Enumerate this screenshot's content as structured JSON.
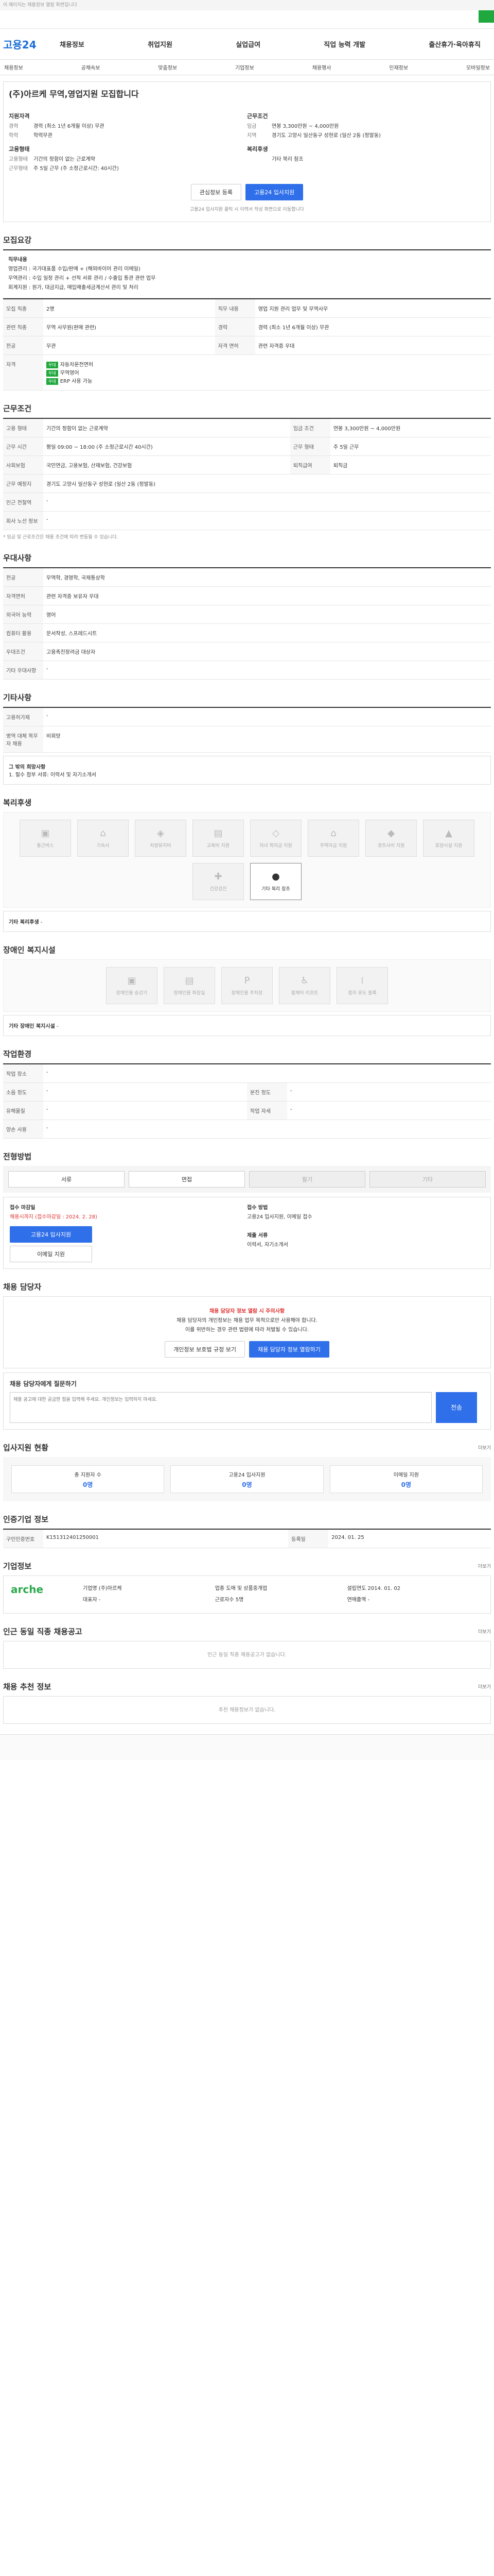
{
  "topbar": {
    "notice": "이 페이지는 채용정보 열람 화면입니다"
  },
  "logo": "고용24",
  "menu": [
    "채용정보",
    "취업지원",
    "실업급여",
    "직업 능력 개발",
    "출산휴가·육아휴직"
  ],
  "subnav": [
    "채용정보",
    "공채속보",
    "맞춤정보",
    "기업정보",
    "채용행사",
    "인재정보",
    "모바일정보"
  ],
  "job": {
    "title": "(주)아르케 무역,영업지원 모집합니다",
    "left_label": "지원자격",
    "left": [
      {
        "k": "경력",
        "v": "경력 (최소 1년 6개월 이상) 무관"
      },
      {
        "k": "학력",
        "v": "학력무관"
      }
    ],
    "left_label2": "고용형태",
    "left2": [
      {
        "k": "고용형태",
        "v": "기간의 정함이 없는 근로계약"
      },
      {
        "k": "근무형태",
        "v": "주 5일 근무 (주 소정근로시간: 40시간)"
      }
    ],
    "right_label": "근무조건",
    "right": [
      {
        "k": "임금",
        "v": "연봉 3,300만원 ~ 4,000만원"
      },
      {
        "k": "지역",
        "v": "경기도 고양시 일산동구 성현로 (일산 2동 (정발동)"
      }
    ],
    "right_label2": "복리후생",
    "right2": [
      {
        "k": "",
        "v": "기타 복리 참조"
      }
    ],
    "btn_save": "관심정보 등록",
    "btn_apply": "고용24 입사지원",
    "fine": "고용24 입사지원 클릭 시 이력서 작성 화면으로 이동합니다"
  },
  "sections": {
    "recruit": "모집요강",
    "workcond": "근무조건",
    "welfare": "복리후생",
    "disabled": "장애인 복지시설",
    "extra": "우대사항",
    "req": "기타사항",
    "manager": "채용 담당자",
    "method": "전형방법",
    "apply": "접수방법",
    "stat": "입사지원 현황",
    "company": "기업정보",
    "other": "인근 동일 직종 채용공고",
    "rec": "채용 추천 정보"
  },
  "recruit": {
    "desc_title": "직무내용",
    "desc_lines": [
      "영업관리 : 국가대표품 수입/판매 + (해외바이어 관리 이메일)",
      "무역관리 : 수입 일정 관리 + 선적 서류 관리 / 수출입 통관 관련 업무",
      "회계지원 : 원가, 대금지급, 매입매출세금계산서 관리 및 처리"
    ],
    "rows": [
      {
        "k": "모집 직종",
        "v": "2명"
      },
      {
        "k": "직무 내용",
        "v": "영업 지원 관리 업무 및 무역사무"
      },
      {
        "k": "관련 직종",
        "v": "무역 사무원(판매 관련)"
      },
      {
        "k": "경력",
        "v": "경력 (최소 1년 6개월 이상) 무관"
      },
      {
        "k": "전공",
        "v": "무관"
      },
      {
        "k": "자격 면허",
        "v": "관련 자격증 우대"
      }
    ],
    "tags": [
      {
        "tag": "우대",
        "text": "자동차운전면허"
      },
      {
        "tag": "우대",
        "text": "무역영어"
      },
      {
        "tag": "우대",
        "text": "ERP 사용 가능"
      }
    ]
  },
  "workcond": {
    "rows": [
      {
        "k": "고용 형태",
        "v": "기간의 정함이 없는 근로계약"
      },
      {
        "k": "임금 조건",
        "v": "연봉 3,300만원 ~ 4,000만원"
      },
      {
        "k": "근무 시간",
        "v": "평일 09:00 ~ 18:00 (주 소정근로시간 40시간)"
      },
      {
        "k": "근무 형태",
        "v": "주 5일 근무"
      },
      {
        "k": "사회보험",
        "v": "국민연금, 고용보험, 산재보험, 건강보험"
      },
      {
        "k": "퇴직급여",
        "v": "퇴직금"
      },
      {
        "k": "근무 예정지",
        "v": "경기도 고양시 일산동구 성현로 (일산 2동 (정발동)"
      },
      {
        "k": "인근 전철역",
        "v": "-"
      },
      {
        "k": "회사 노선 정보",
        "v": "-"
      }
    ],
    "note": "* 임금 및 근로조건은 채용 조건에 따라 변동될 수 있습니다."
  },
  "extra": {
    "rows": [
      {
        "k": "전공",
        "v": "무역학, 경영학, 국제통상학"
      },
      {
        "k": "자격면허",
        "v": "관련 자격증 보유자 우대"
      },
      {
        "k": "외국어 능력",
        "v": "영어"
      },
      {
        "k": "컴퓨터 활용",
        "v": "문서작성, 스프레드시트"
      },
      {
        "k": "우대조건",
        "v": "고용촉진장려금 대상자"
      },
      {
        "k": "기타 우대사항",
        "v": "-"
      }
    ]
  },
  "req": {
    "rows": [
      {
        "k": "고용허가제",
        "v": "-"
      },
      {
        "k": "병역 대체 복무자 채용",
        "v": "비희망"
      }
    ],
    "etc_title": "그 밖의 희망사항",
    "etc": "1. 필수 첨부 서류: 이력서 및 자기소개서"
  },
  "welfare": {
    "items": [
      "통근버스",
      "기숙사",
      "차량유지비",
      "교육비 지원",
      "자녀 학자금 지원",
      "주택자금 지원",
      "경조사비 지원",
      "휴양시설 지원",
      "건강검진",
      "기타 복리 참조"
    ],
    "note": "기타 복리후생",
    "note_v": "-"
  },
  "disabled": {
    "items": [
      "장애인용 승강기",
      "장애인용 화장실",
      "장애인용 주차장",
      "휠체어 리프트",
      "점자 유도 블록"
    ],
    "note": "기타 장애인 복지시설",
    "note_v": "-"
  },
  "workplace": {
    "title": "작업환경",
    "rows": [
      {
        "k": "작업 장소",
        "v": "-"
      },
      {
        "k": "소음 정도",
        "v": "-"
      },
      {
        "k": "분진 정도",
        "v": "-"
      },
      {
        "k": "유해물질",
        "v": "-"
      },
      {
        "k": "작업 자세",
        "v": "-"
      },
      {
        "k": "양손 사용",
        "v": "-"
      }
    ]
  },
  "method": {
    "items": [
      "서류",
      "면접",
      "필기",
      "기타"
    ],
    "off": [
      false,
      false,
      true,
      true
    ]
  },
  "apply": {
    "left_title": "접수 마감일",
    "left_date": "채용시까지 (접수마감일 : 2024. 2. 28)",
    "btn1": "고용24 입사지원",
    "btn2": "이메일 지원",
    "right_title": "접수 방법",
    "right": "고용24 입사지원, 이메일 접수",
    "right_title2": "제출 서류",
    "right2": "이력서, 자기소개서"
  },
  "manager": {
    "alert": "채용 담당자 정보 열람 시 주의사항",
    "line1": "채용 담당자의 개인정보는 채용 업무 목적으로만 사용해야 합니다.",
    "line2": "이를 위반하는 경우 관련 법령에 따라 처벌될 수 있습니다.",
    "btn1": "개인정보 보호법 규정 보기",
    "btn2": "채용 담당자 정보 열람하기",
    "q_title": "채용 담당자에게 질문하기",
    "q_placeholder": "채용 공고에 대한 궁금한 점을 입력해 주세요. 개인정보는 입력하지 마세요.",
    "q_btn": "전송"
  },
  "stat": {
    "items": [
      {
        "label": "총 지원자 수",
        "value": "0명"
      },
      {
        "label": "고용24 입사지원",
        "value": "0명"
      },
      {
        "label": "이메일 지원",
        "value": "0명"
      }
    ]
  },
  "registered": {
    "title": "인증기업 정보",
    "rows": [
      {
        "k": "구인인증번호",
        "v": "K151312401250001"
      },
      {
        "k": "등록일",
        "v": "2024. 01. 25"
      }
    ]
  },
  "company": {
    "logo": "arche",
    "info": [
      {
        "k": "기업명",
        "v": "(주)아르케"
      },
      {
        "k": "업종",
        "v": "도매 및 상품중개업"
      },
      {
        "k": "설립연도",
        "v": "2014. 01. 02"
      },
      {
        "k": "대표자",
        "v": "-"
      },
      {
        "k": "근로자수",
        "v": "5명"
      },
      {
        "k": "연매출액",
        "v": "-"
      }
    ]
  },
  "other": {
    "empty": "인근 동일 직종 채용공고가 없습니다."
  },
  "rec": {
    "empty": "추천 채용정보가 없습니다."
  },
  "more": "더보기"
}
